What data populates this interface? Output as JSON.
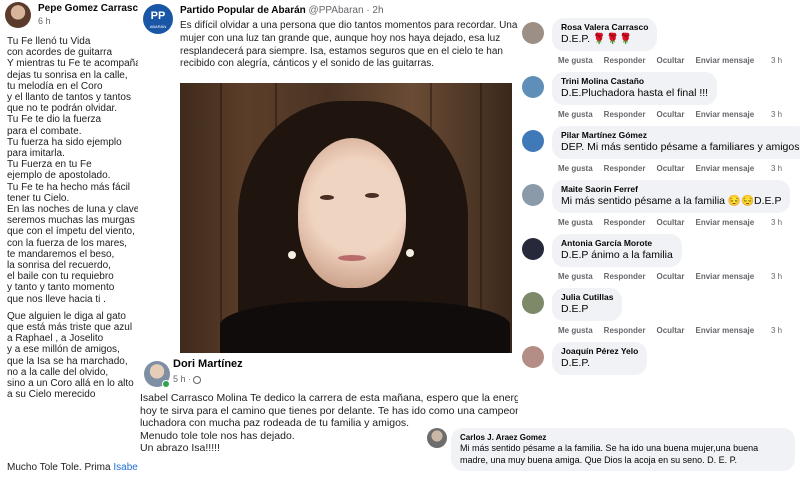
{
  "left_post": {
    "author": "Pepe Gomez Carrasco",
    "time": "6 h",
    "poem": [
      "Tu Fe llenó tu Vida",
      " con acordes de guitarra",
      "Y mientras tu Fe te acompaña",
      "dejas tu sonrisa en la calle,",
      "tu melodía en el Coro",
      "y el llanto de tantos y tantos",
      "que no te podrán olvidar.",
      "Tu Fe te dio la fuerza",
      "para el combate.",
      "Tu fuerza ha sido ejemplo",
      "para imitarla.",
      "Tu Fuerza en tu Fe",
      "ejemplo de apostolado.",
      "Tu Fe te ha hecho más fácil",
      "tener tu Cielo.",
      "En las noches de luna y clavel",
      "seremos muchas las murgas",
      "que con el ímpetu del viento,",
      "con la fuerza de los mares,",
      "te mandaremos el beso,",
      "la sonrisa del recuerdo,",
      "el baile con tu requiebro",
      "y tanto y tanto momento",
      "que nos lleve hacia ti .",
      "",
      "Que alguien le diga al gato",
      "que está más triste que azul",
      "a Raphael , a Joselito",
      "y a ese millón de amigos,",
      "que la Isa se ha marchado,",
      "no a la calle del olvido,",
      "sino a un Coro allá en lo alto",
      "a su Cielo merecido"
    ],
    "signoff": "Mucho Tole Tole. Prima ",
    "signoff_link": "Isabel Carrasco Molina."
  },
  "center_post": {
    "page_name": "Partido Popular de Abarán",
    "handle": "@PPAbaran · 2h",
    "logo_text": "PP",
    "logo_sub": "ABARÁN",
    "text": "Es difícil olvidar a una persona que dio tantos momentos para recordar. Una mujer con una luz tan grande que, aunque hoy nos haya dejado, esa luz resplandecerá para siempre. Isa, estamos seguros que en el cielo te han recibido con alegría, cánticos y el sonido de las guitarras."
  },
  "dori_post": {
    "name": "Dori Martínez",
    "time": "5 h ·",
    "lines": [
      "Isabel Carrasco Molina Te dedico la carrera de esta mañana, espero que la energía y la fuerza de",
      "hoy te sirva  para el camino que tienes por delante. Te has ido como una campeona, una",
      "luchadora con mucha  paz rodeada de tu familia y amigos.",
      "Menudo tole tole nos has dejado.",
      "Un abrazo Isa!!!!!"
    ]
  },
  "actions": {
    "like": "Me gusta",
    "reply": "Responder",
    "hide": "Ocultar",
    "send": "Enviar mensaje"
  },
  "comments": [
    {
      "name": "Rosa Valera Carrasco",
      "text": "D.E.P. 🌹🌹🌹",
      "ago": "3 h",
      "avatar_color": "#9c8f86"
    },
    {
      "name": "Trini Molina Castaño",
      "text": "D.E.Pluchadora hasta el final !!!",
      "ago": "3 h",
      "avatar_color": "#5f8fb8"
    },
    {
      "name": "Pilar Martínez Gómez",
      "text": "DEP. Mi más sentido pésame a familiares y amigos",
      "ago": "3 h",
      "avatar_color": "#3f79b8"
    },
    {
      "name": "Maite Saorin Ferref",
      "text": "Mi más sentido pésame a la familia 😔😔D.E.P",
      "ago": "3 h",
      "avatar_color": "#8a9aa8"
    },
    {
      "name": "Antonia García Morote",
      "text": "D.E.P ánimo a la familia",
      "ago": "3 h",
      "avatar_color": "#26293a"
    },
    {
      "name": "Julia Cutillas",
      "text": "D.E.P",
      "ago": "3 h",
      "avatar_color": "#7c8a6a"
    },
    {
      "name": "Joaquín Pérez Yelo",
      "text": "D.E.P.",
      "ago": "",
      "avatar_color": "#b48d86"
    }
  ],
  "bottom_comment": {
    "name": "Carlos J. Araez Gomez",
    "text": "Mi más sentido pésame a la familia. Se ha ido una buena mujer,una buena madre, una muy buena amiga. Que Dios la acoja en su seno. D. E. P."
  }
}
